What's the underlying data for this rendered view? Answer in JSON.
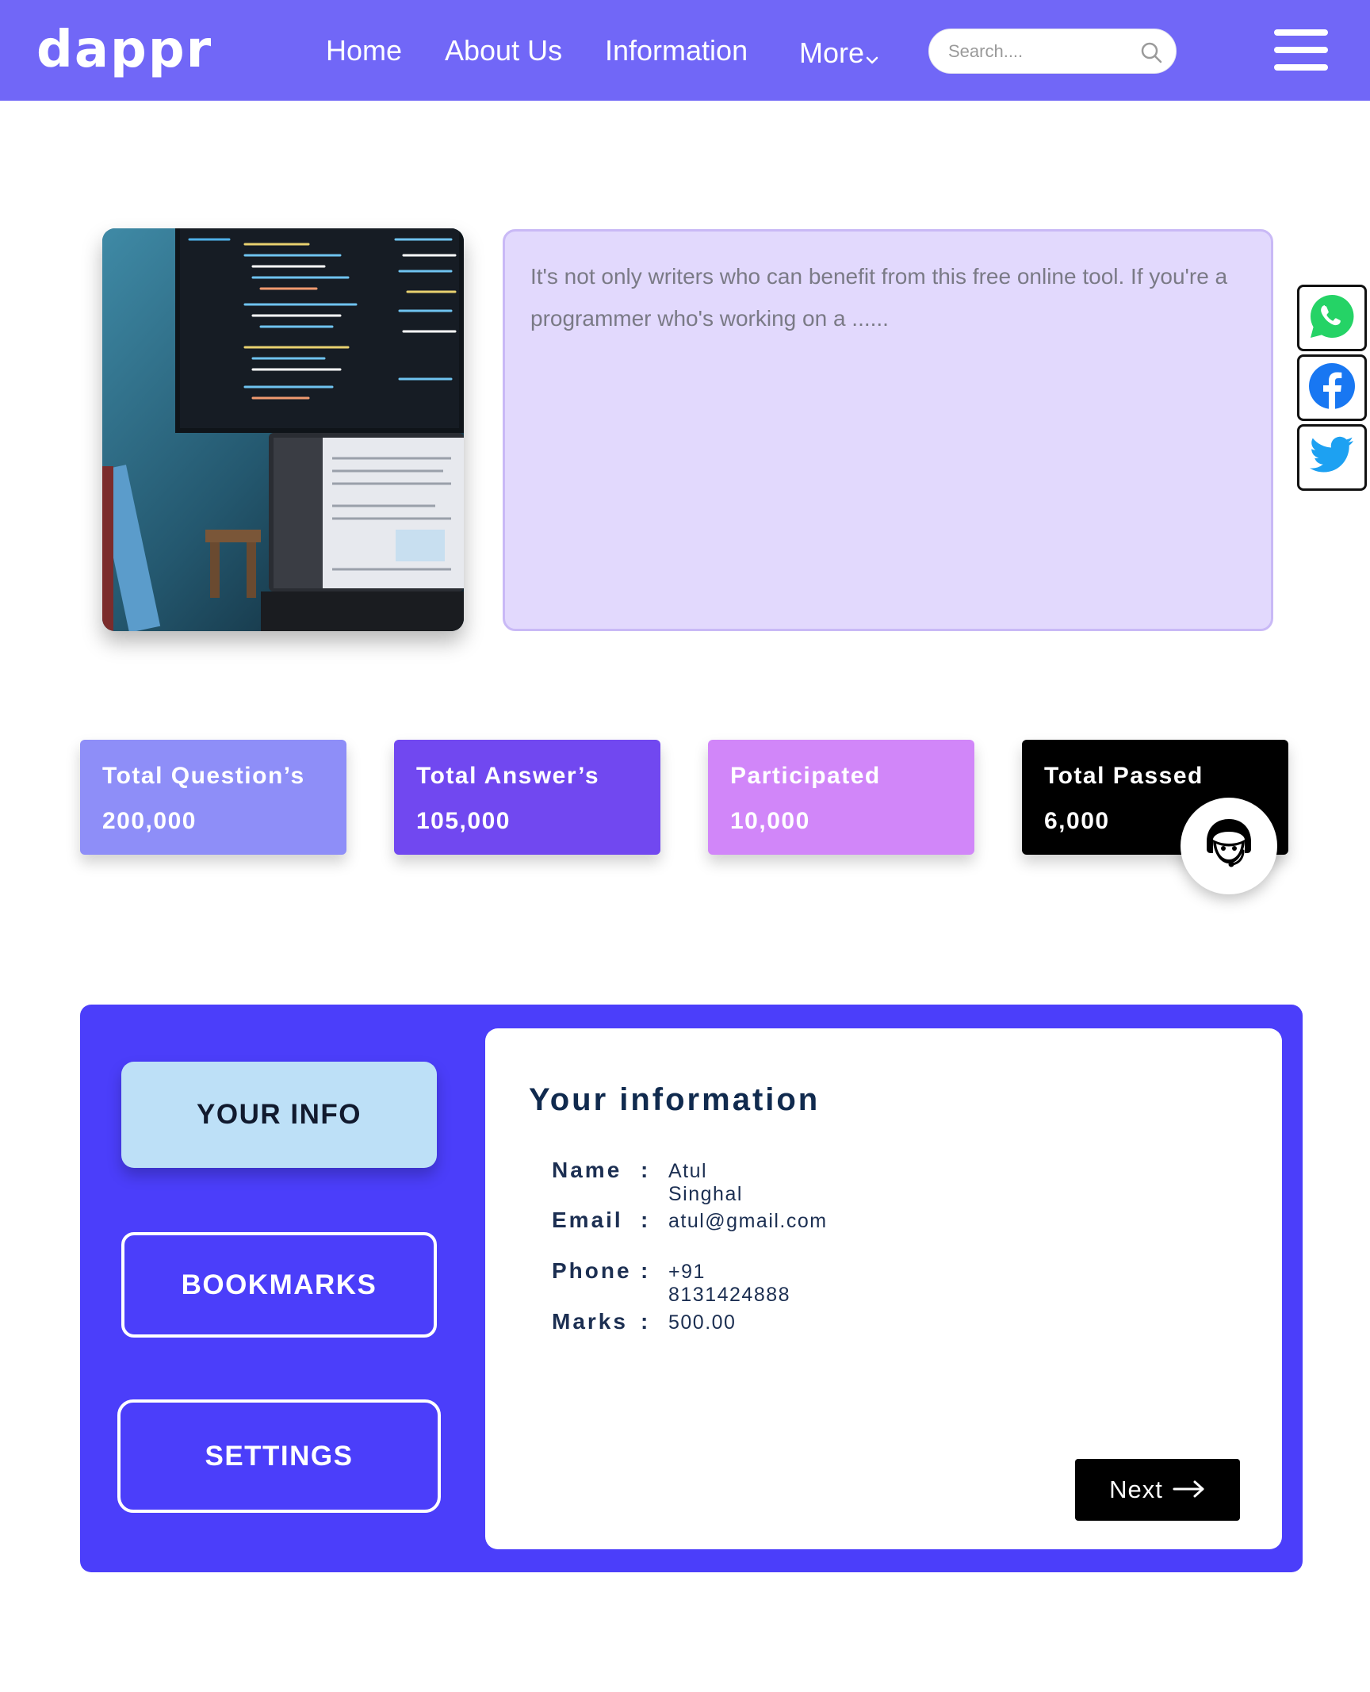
{
  "header": {
    "logo": "dappr",
    "nav": {
      "home": "Home",
      "about": "About Us",
      "information": "Information",
      "more": "More"
    },
    "search": {
      "placeholder": "Search...."
    },
    "menu_icon": "hamburger-icon"
  },
  "hero": {
    "image_icon": "workspace-code-image",
    "text": "It's not only writers who can benefit from this free online tool. If you're a programmer who's working on a ......"
  },
  "social": [
    {
      "name": "whatsapp",
      "icon": "whatsapp-icon",
      "color": "#25D366"
    },
    {
      "name": "facebook",
      "icon": "facebook-icon",
      "color": "#1877F2"
    },
    {
      "name": "twitter",
      "icon": "twitter-icon",
      "color": "#1DA1F2"
    }
  ],
  "stats": [
    {
      "label": "Total Question’s",
      "value": "200,000",
      "color": "#8e8ef8"
    },
    {
      "label": "Total Answer’s",
      "value": "105,000",
      "color": "#7148f0"
    },
    {
      "label": "Participated",
      "value": "10,000",
      "color": "#d186f9"
    },
    {
      "label": "Total Passed",
      "value": "6,000",
      "color": "#000000"
    }
  ],
  "support_icon": "support-agent-icon",
  "profile": {
    "menu": {
      "your_info": "YOUR INFO",
      "bookmarks": "BOOKMARKS",
      "settings": "SETTINGS"
    },
    "title": "Your information",
    "fields": {
      "name": {
        "label": "Name",
        "sep": ":",
        "value": "Atul Singhal"
      },
      "email": {
        "label": "Email",
        "sep": ":",
        "value": "atul@gmail.com"
      },
      "phone": {
        "label": "Phone",
        "sep": ":",
        "value": "+91 8131424888"
      },
      "marks": {
        "label": "Marks",
        "sep": ":",
        "value": "500.00"
      }
    },
    "next_label": "Next"
  },
  "colors": {
    "nav_bg": "#7167f7",
    "panel_bg": "#4b3efa",
    "hero_box_bg": "#e2d9fd",
    "active_tab_bg": "#bde0f7"
  }
}
